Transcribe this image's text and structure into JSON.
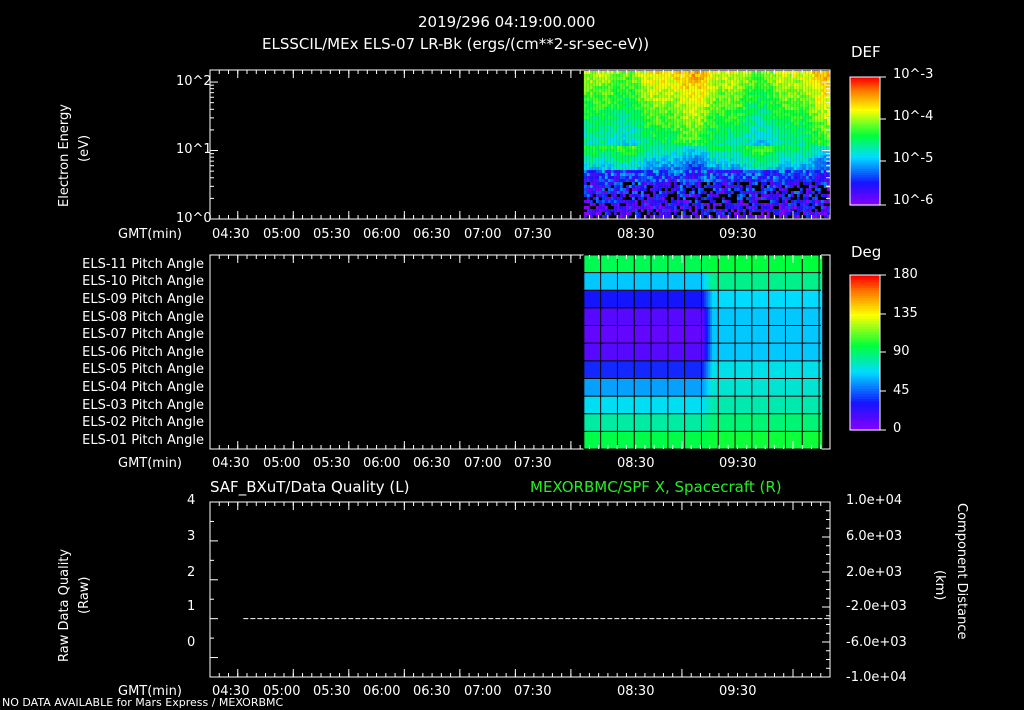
{
  "header": {
    "timestamp": "2019/296 04:19:00.000",
    "subtitle": "ELSSCIL/MEx ELS-07 LR-Bk  (ergs/(cm**2-sr-sec-eV))"
  },
  "time_axis": {
    "label": "GMT(min)",
    "ticks": [
      "04:30",
      "05:00",
      "05:30",
      "06:00",
      "06:30",
      "07:00",
      "07:30",
      "08:30",
      "09:30"
    ],
    "range_min": [
      255,
      590
    ]
  },
  "panel1": {
    "ylabel_line1": "Electron Energy",
    "ylabel_line2": "(eV)",
    "y_ticks": [
      "10^0",
      "10^1",
      "10^2"
    ],
    "colorbar_title": "DEF",
    "colorbar_ticks": [
      "10^-3",
      "10^-4",
      "10^-5",
      "10^-6"
    ],
    "data_start_min": 457
  },
  "panel2": {
    "row_labels": [
      "ELS-11 Pitch Angle",
      "ELS-10 Pitch Angle",
      "ELS-09 Pitch Angle",
      "ELS-08 Pitch Angle",
      "ELS-07 Pitch Angle",
      "ELS-06 Pitch Angle",
      "ELS-05 Pitch Angle",
      "ELS-04 Pitch Angle",
      "ELS-03 Pitch Angle",
      "ELS-02 Pitch Angle",
      "ELS-01 Pitch Angle"
    ],
    "colorbar_title": "Deg",
    "colorbar_ticks": [
      "180",
      "135",
      "90",
      "45",
      "0"
    ]
  },
  "panel3": {
    "title_left": "SAF_BXuT/Data Quality (L)",
    "title_right": "MEXORBMC/SPF X, Spacecraft (R)",
    "ylabel_left_line1": "Raw Data Quality",
    "ylabel_left_line2": "(Raw)",
    "ylabel_right_line1": "Component Distance",
    "ylabel_right_line2": "(km)",
    "y_ticks_left": [
      "4",
      "3",
      "2",
      "1",
      "0"
    ],
    "y_ticks_right": [
      "1.0e+04",
      "6.0e+03",
      "2.0e+03",
      "-2.0e+03",
      "-6.0e+03",
      "-1.0e+04"
    ]
  },
  "footer_note": "NO DATA AVAILABLE for Mars Express / MEXORBMC",
  "chart_data": [
    {
      "type": "heatmap",
      "title": "ELSSCIL/MEx ELS-07 LR-Bk  (ergs/(cm**2-sr-sec-eV))",
      "ylabel": "Electron Energy (eV)",
      "y_scale": "log",
      "ylim": [
        1,
        150
      ],
      "x_ticks": [
        "04:30",
        "05:00",
        "05:30",
        "06:00",
        "06:30",
        "07:00",
        "07:30",
        "08:30",
        "09:30"
      ],
      "data_start": "07:37",
      "colorbar": {
        "label": "DEF",
        "range": [
          1e-06,
          0.001
        ],
        "scale": "log"
      }
    },
    {
      "type": "heatmap",
      "rows": [
        "ELS-11",
        "ELS-10",
        "ELS-09",
        "ELS-08",
        "ELS-07",
        "ELS-06",
        "ELS-05",
        "ELS-04",
        "ELS-03",
        "ELS-02",
        "ELS-01"
      ],
      "x_ticks": [
        "04:30",
        "05:00",
        "05:30",
        "06:00",
        "06:30",
        "07:00",
        "07:30",
        "08:30",
        "09:30"
      ],
      "data_start": "07:37",
      "colorbar": {
        "label": "Deg",
        "range": [
          0,
          180
        ]
      }
    },
    {
      "type": "line",
      "series": [
        {
          "name": "SAF_BXuT/Data Quality (L)",
          "x": [
            "04:33",
            "09:50"
          ],
          "y": [
            1,
            1
          ],
          "color": "#ffffff",
          "dash": true
        }
      ],
      "ylim_left": [
        -0.5,
        4
      ],
      "ylim_right": [
        -10000,
        10000
      ],
      "x_ticks": [
        "04:30",
        "05:00",
        "05:30",
        "06:00",
        "06:30",
        "07:00",
        "07:30",
        "08:30",
        "09:30"
      ]
    }
  ]
}
